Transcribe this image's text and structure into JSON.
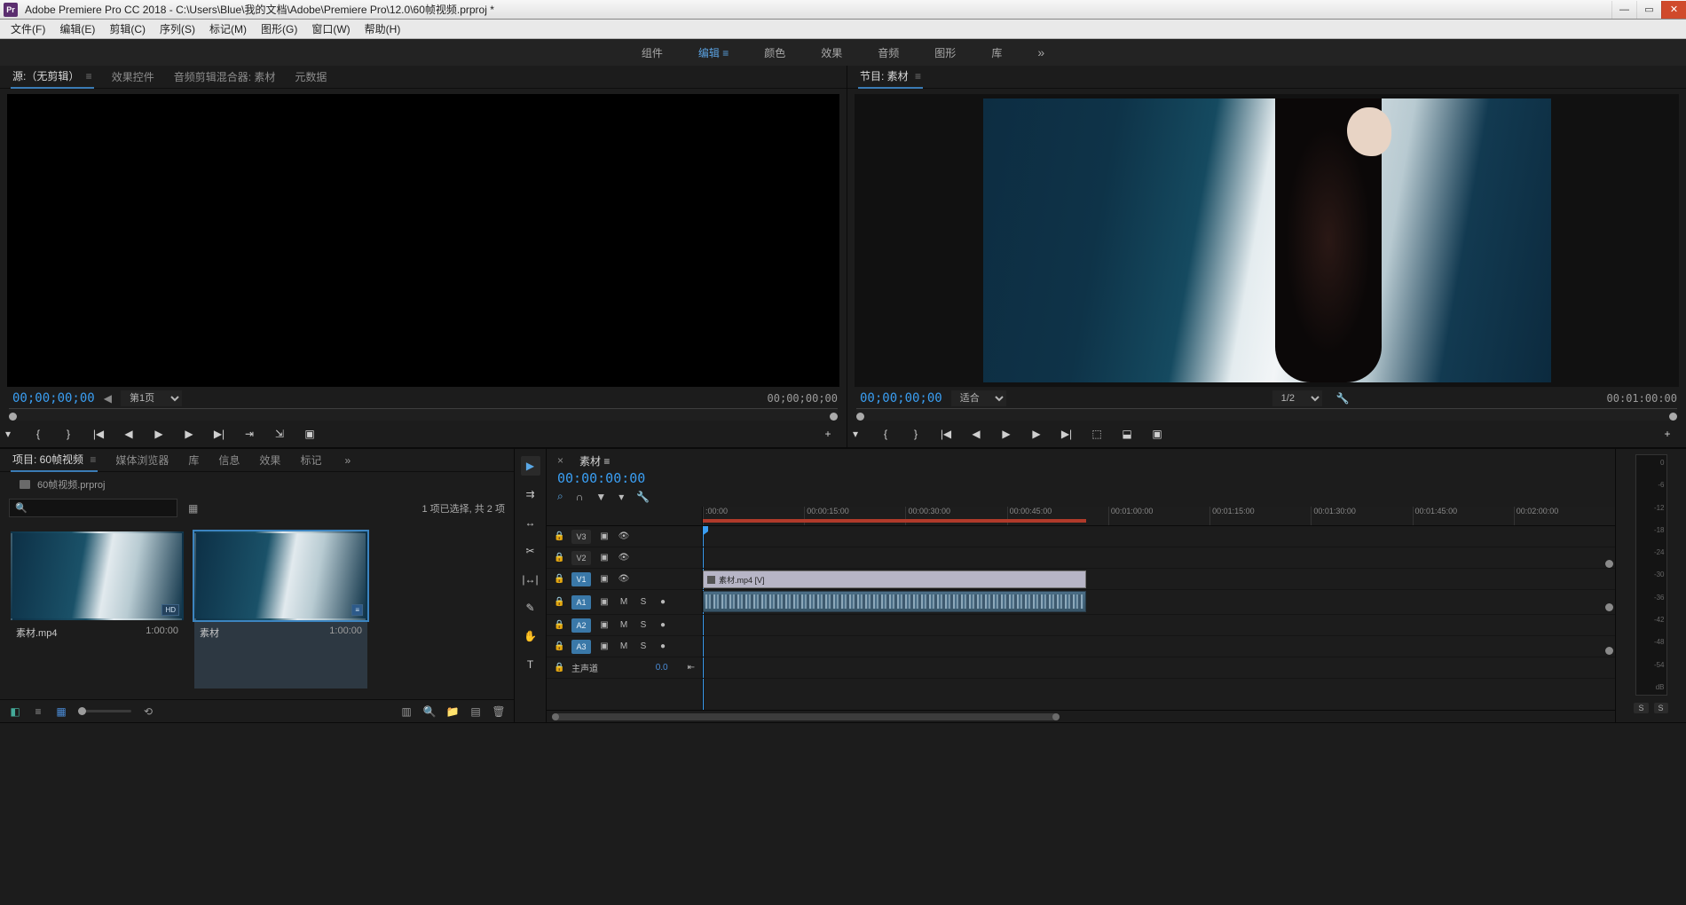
{
  "titlebar": {
    "app": "Adobe Premiere Pro CC 2018",
    "path": "C:\\Users\\Blue\\我的文档\\Adobe\\Premiere Pro\\12.0\\60帧视频.prproj *"
  },
  "menubar": [
    "文件(F)",
    "编辑(E)",
    "剪辑(C)",
    "序列(S)",
    "标记(M)",
    "图形(G)",
    "窗口(W)",
    "帮助(H)"
  ],
  "workspaces": [
    "组件",
    "编辑",
    "颜色",
    "效果",
    "音频",
    "图形",
    "库"
  ],
  "workspace_active": "编辑",
  "source": {
    "tabs": [
      "源:（无剪辑）",
      "效果控件",
      "音频剪辑混合器: 素材",
      "元数据"
    ],
    "active": "源:（无剪辑）",
    "tc_left": "00;00;00;00",
    "page": "第1页",
    "tc_right": "00;00;00;00"
  },
  "program": {
    "title": "节目: 素材",
    "tc_left": "00;00;00;00",
    "fit": "适合",
    "zoom": "1/2",
    "tc_right": "00:01:00:00"
  },
  "project": {
    "tabs": [
      "项目: 60帧视频",
      "媒体浏览器",
      "库",
      "信息",
      "效果",
      "标记"
    ],
    "active": "项目: 60帧视频",
    "filename": "60帧视频.prproj",
    "count": "1 项已选择, 共 2 项",
    "items": [
      {
        "name": "素材.mp4",
        "dur": "1:00:00",
        "badges": [
          "HD"
        ],
        "selected": false
      },
      {
        "name": "素材",
        "dur": "1:00:00",
        "badges": [
          "≡"
        ],
        "selected": true
      }
    ]
  },
  "timeline": {
    "tab": "素材",
    "tc": "00:00:00:00",
    "ticks": [
      ":00:00",
      "00:00:15:00",
      "00:00:30:00",
      "00:00:45:00",
      "00:01:00:00",
      "00:01:15:00",
      "00:01:30:00",
      "00:01:45:00",
      "00:02:00:00"
    ],
    "v_tracks": [
      "V3",
      "V2",
      "V1"
    ],
    "a_tracks": [
      "A1",
      "A2",
      "A3"
    ],
    "master": "主声道",
    "master_val": "0.0",
    "clip_name": "素材.mp4 [V]"
  },
  "meters": {
    "marks": [
      "0",
      "-6",
      "-12",
      "-18",
      "-24",
      "-30",
      "-36",
      "-42",
      "-48",
      "-54",
      "dB"
    ],
    "solo": [
      "S",
      "S"
    ]
  }
}
